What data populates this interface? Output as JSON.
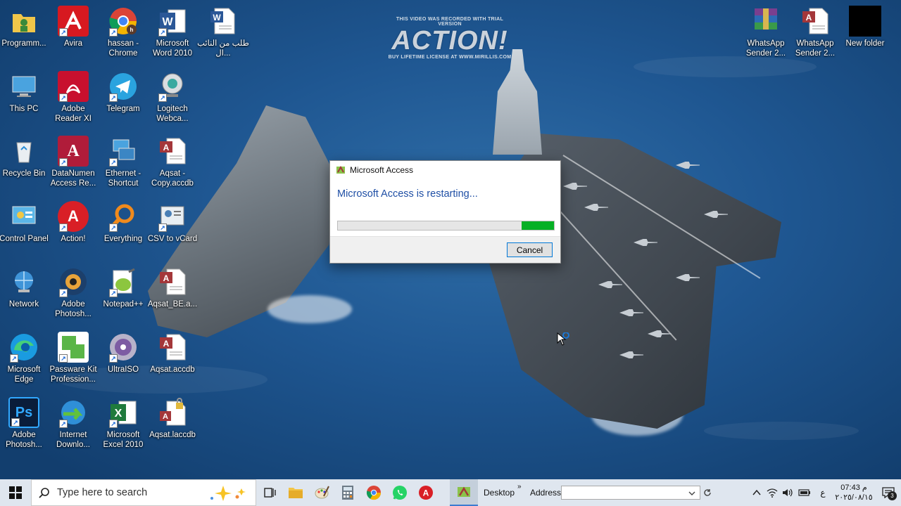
{
  "watermark": {
    "top": "THIS VIDEO WAS RECORDED WITH TRIAL VERSION",
    "main": "ACTION!",
    "bottom": "BUY LIFETIME LICENSE AT WWW.MIRILLIS.COM"
  },
  "desktop_icons": [
    {
      "label": "Programm...",
      "icon": "folder-user-icon"
    },
    {
      "label": "Avira",
      "icon": "avira-icon"
    },
    {
      "label": "hassan - Chrome",
      "icon": "chrome-icon"
    },
    {
      "label": "Microsoft Word 2010",
      "icon": "word-icon"
    },
    {
      "label": "طلب من النائب ال...",
      "icon": "word-document-icon"
    },
    {
      "label": "This PC",
      "icon": "computer-icon"
    },
    {
      "label": "Adobe Reader XI",
      "icon": "adobe-reader-icon"
    },
    {
      "label": "Telegram",
      "icon": "telegram-icon"
    },
    {
      "label": "Logitech Webca...",
      "icon": "webcam-icon"
    },
    {
      "label": "Recycle Bin",
      "icon": "recycle-bin-icon"
    },
    {
      "label": "DataNumen Access Re...",
      "icon": "datanumen-icon"
    },
    {
      "label": "Ethernet - Shortcut",
      "icon": "ethernet-icon"
    },
    {
      "label": "Aqsat - Copy.accdb",
      "icon": "access-file-icon"
    },
    {
      "label": "Control Panel",
      "icon": "control-panel-icon"
    },
    {
      "label": "Action!",
      "icon": "action-icon"
    },
    {
      "label": "Everything",
      "icon": "everything-search-icon"
    },
    {
      "label": "CSV to vCard",
      "icon": "csv-vcard-icon"
    },
    {
      "label": "Network",
      "icon": "network-icon"
    },
    {
      "label": "Adobe Photosh...",
      "icon": "photoshop-old-icon"
    },
    {
      "label": "Notepad++",
      "icon": "notepadpp-icon"
    },
    {
      "label": "Aqsat_BE.a...",
      "icon": "access-file-icon"
    },
    {
      "label": "Microsoft Edge",
      "icon": "edge-icon"
    },
    {
      "label": "Passware Kit Profession...",
      "icon": "passware-icon"
    },
    {
      "label": "UltraISO",
      "icon": "ultraiso-icon"
    },
    {
      "label": "Aqsat.accdb",
      "icon": "access-file-icon"
    },
    {
      "label": "Adobe Photosh...",
      "icon": "photoshop-icon"
    },
    {
      "label": "Internet Downlo...",
      "icon": "idm-icon"
    },
    {
      "label": "Microsoft Excel 2010",
      "icon": "excel-icon"
    },
    {
      "label": "Aqsat.laccdb",
      "icon": "access-lock-file-icon"
    },
    {
      "label": "WhatsApp Sender 2...",
      "icon": "winrar-icon"
    },
    {
      "label": "WhatsApp Sender 2...",
      "icon": "access-file-icon"
    },
    {
      "label": "New folder",
      "icon": "black-folder-icon"
    }
  ],
  "dialog": {
    "title": "Microsoft Access",
    "message": "Microsoft Access is restarting...",
    "progress": 0.85,
    "cancel_label": "Cancel"
  },
  "taskbar": {
    "search_placeholder": "Type here to search",
    "desktop_label": "Desktop",
    "chevron": "»",
    "address_label": "Address",
    "address_value": "",
    "lang": "ع",
    "time": "07:43 م",
    "date": "٢٠٢٥/٠٨/١٥",
    "notification_count": "3"
  },
  "colors": {
    "progress_fill": "#06b025",
    "dialog_message": "#1f4fa5",
    "taskbar_bg": "#dfe6ef"
  }
}
